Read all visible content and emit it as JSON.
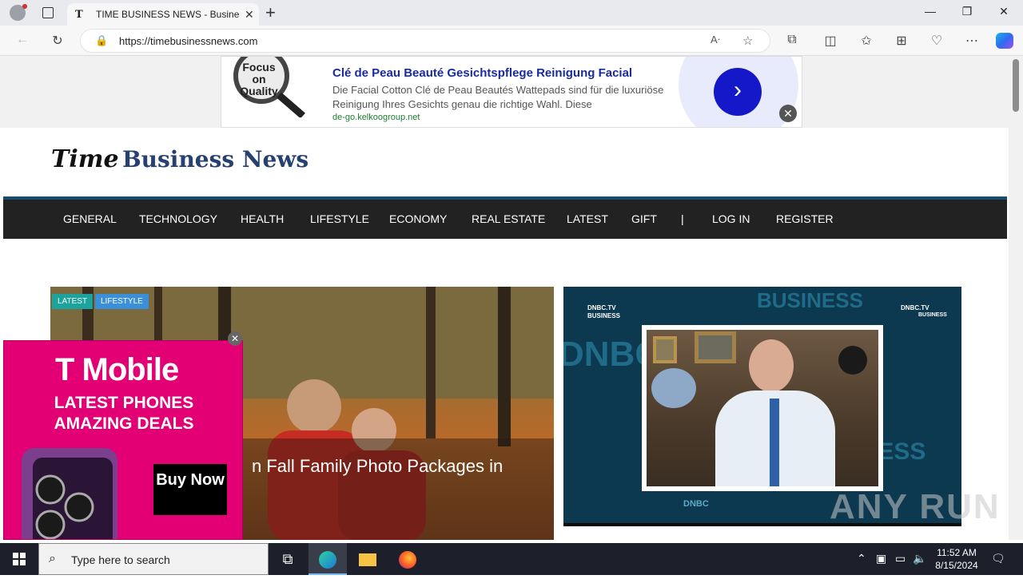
{
  "browser": {
    "tab_title": "TIME BUSINESS NEWS - Business",
    "tab_favicon": "T",
    "new_tab": "+",
    "tab_close": "✕",
    "url": "https://timebusinessnews.com",
    "window_controls": {
      "minimize": "—",
      "restore": "❐",
      "close": "✕"
    }
  },
  "top_ad": {
    "lens_text": "Focus on Quality",
    "title": "Clé de Peau Beauté Gesichtspflege Reinigung Facial",
    "description": "Die Facial Cotton Clé de Peau Beautés Wattepads sind für die luxuriöse Reinigung Ihres Gesichts genau die richtige Wahl. Diese",
    "domain": "de-go.kelkoogroup.net",
    "arrow": "›",
    "close": "✕"
  },
  "site": {
    "logo_part1": "Time",
    "logo_part2": "Business News",
    "nav": [
      "GENERAL",
      "TECHNOLOGY",
      "HEALTH",
      "LIFESTYLE",
      "ECONOMY",
      "REAL ESTATE",
      "LATEST",
      "GIFT",
      "|",
      "LOG IN",
      "REGISTER"
    ]
  },
  "hero": {
    "tags": [
      "LATEST",
      "LIFESTYLE"
    ],
    "headline": "n Fall Family Photo Packages in"
  },
  "video": {
    "bg_word": "BUSINESS",
    "bg_word2": "DNBC",
    "channel": "DNBC.TV",
    "channel_sub": "BUSINESS",
    "corner_channel": "DNBC.TV",
    "corner_sub": "BUSINESS",
    "footer_logo": "DNBC"
  },
  "side_ad": {
    "brand": "T Mobile",
    "line1": "LATEST PHONES",
    "line2": "AMAZING DEALS",
    "cta": "Buy Now",
    "close": "✕"
  },
  "watermark": "ANY RUN",
  "taskbar": {
    "search_placeholder": "Type here to search",
    "time": "11:52 AM",
    "date": "8/15/2024"
  },
  "colors": {
    "nav_bg": "#222222",
    "accent": "#1b4d6b",
    "tag_latest": "#1ba39c",
    "tag_lifestyle": "#3a8fd8",
    "tmobile": "#e20074",
    "ad_button": "#1418c8"
  }
}
